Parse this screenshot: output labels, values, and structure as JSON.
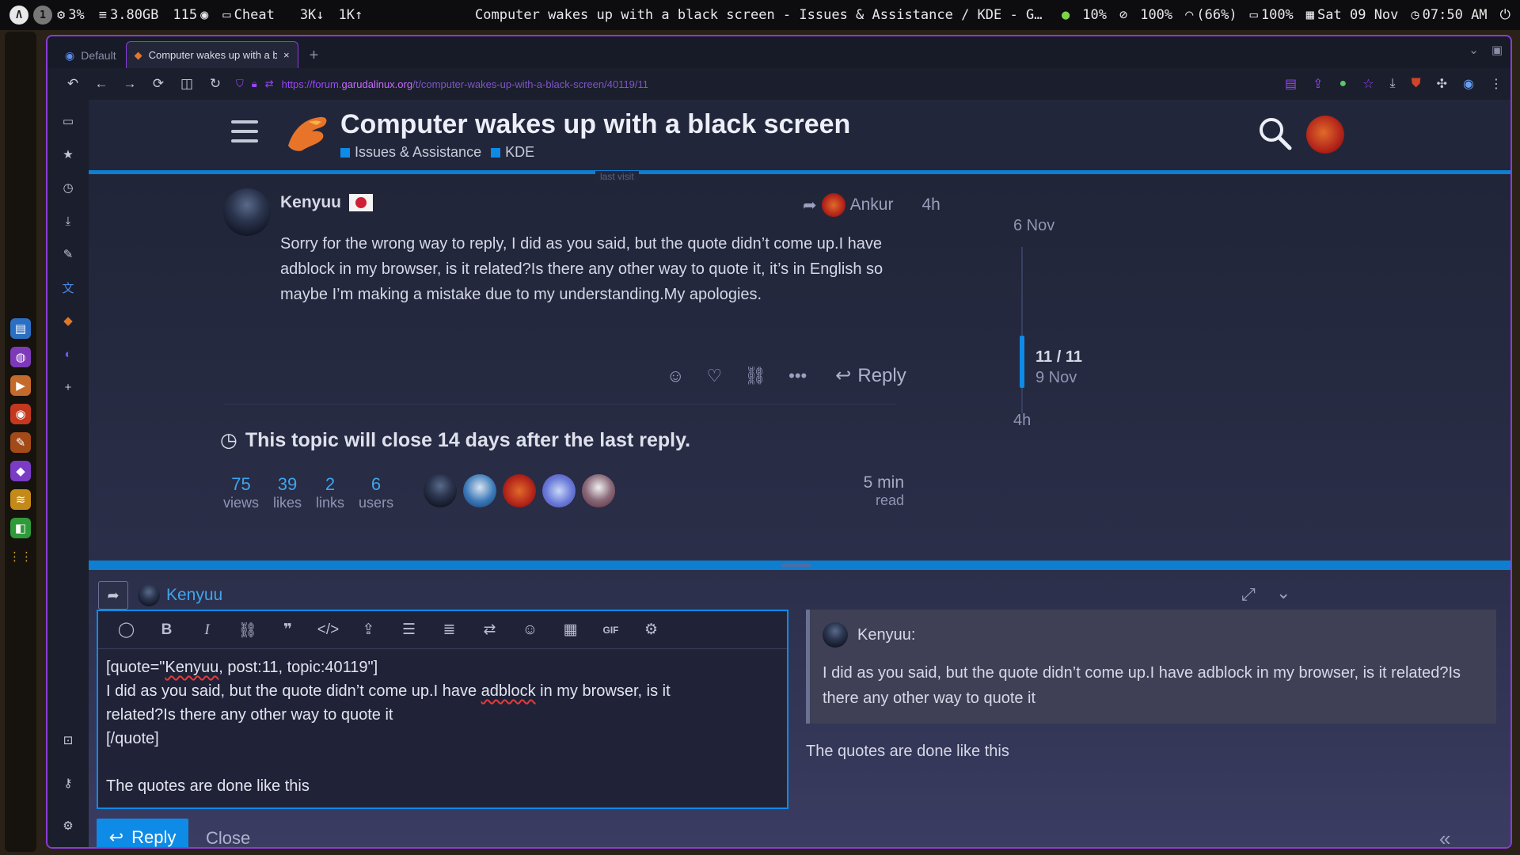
{
  "sysbar": {
    "workspaces": [
      "1"
    ],
    "cpu": "3%",
    "mem": "3.80GB",
    "procs": "115",
    "cheat": "Cheat",
    "down": "3K↓",
    "up": "1K↑",
    "window_title": "Computer wakes up with a black screen - Issues & Assistance / KDE - Garuda Linu…",
    "status1": "10%",
    "status2": "100%",
    "wifi": "(66%)",
    "battery": "100%",
    "date": "Sat 09 Nov",
    "time": "07:50 AM"
  },
  "browser": {
    "tab_default": "Default",
    "tab_active": "Computer wakes up with a b",
    "url_scheme": "https://forum.",
    "url_host": "garudalinux.org",
    "url_path": "/t/computer-wakes-up-with-a-black-screen/40119/11"
  },
  "topic": {
    "title": "Computer wakes up with a black screen",
    "categories": [
      "Issues & Assistance",
      "KDE"
    ],
    "last_visit": "last visit"
  },
  "post": {
    "author": "Kenyuu",
    "reply_to": "Ankur",
    "age": "4h",
    "body": "Sorry for the wrong way to reply, I did as you said, but the quote didn’t come up.I have adblock in my browser, is it related?Is there any other way to quote it, it’s in English so maybe I’m making a mistake due to my understanding.My apologies.",
    "reply_label": "Reply"
  },
  "timeline": {
    "start_date": "6 Nov",
    "position": "11 / 11",
    "current_date": "9 Nov",
    "end_label": "4h"
  },
  "notice": "This topic will close 14 days after the last reply.",
  "stats": [
    {
      "n": "75",
      "l": "views"
    },
    {
      "n": "39",
      "l": "likes"
    },
    {
      "n": "2",
      "l": "links"
    },
    {
      "n": "6",
      "l": "users"
    }
  ],
  "read_time": {
    "n": "5 min",
    "l": "read"
  },
  "composer": {
    "reply_user": "Kenyuu",
    "editor_lines": {
      "l1a": "[quote=\"",
      "l1b": "Kenyuu",
      "l1c": ", post:11, topic:40119\"]",
      "l2a": "I did as you said, but the quote didn’t come up.I have ",
      "l2b": "adblock",
      "l2c": " in my browser, is it",
      "l3": "related?Is there any other way to quote it",
      "l4": "[/quote]",
      "l6": "The quotes are done like this"
    },
    "preview_quote_user": "Kenyuu:",
    "preview_quote_body": "I did as you said, but the quote didn’t come up.I have adblock in my browser, is it related?Is there any other way to quote it",
    "preview_text": "The quotes are done like this",
    "reply_button": "Reply",
    "close_button": "Close",
    "toolbar_gif": "GIF"
  },
  "colors": {
    "accent": "#0e8be6",
    "browser_border": "#8a3cd8",
    "url": "#9a45ff"
  }
}
